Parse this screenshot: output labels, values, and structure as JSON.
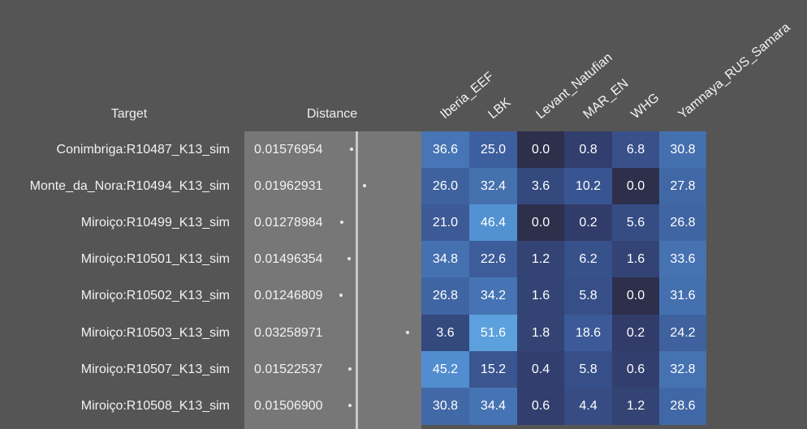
{
  "headers": {
    "target": "Target",
    "distance": "Distance",
    "columns": [
      "Iberia_EEF",
      "LBK",
      "Levant_Natufian",
      "MAR_EN",
      "WHG",
      "Yamnaya_RUS_Samara"
    ]
  },
  "rows": [
    {
      "target": "Conimbriga:R10487_K13_sim",
      "distance": "0.01576954",
      "distance_value": 0.01576954,
      "values": [
        "36.6",
        "25.0",
        "0.0",
        "0.8",
        "6.8",
        "30.8"
      ],
      "colors": [
        "#4775b5",
        "#3e5f9f",
        "#2d2f4b",
        "#323e6e",
        "#38518a",
        "#4570b0"
      ]
    },
    {
      "target": "Monte_da_Nora:R10494_K13_sim",
      "distance": "0.01962931",
      "distance_value": 0.01962931,
      "values": [
        "26.0",
        "32.4",
        "3.6",
        "10.2",
        "0.0",
        "27.8"
      ],
      "colors": [
        "#3f629f",
        "#4571ae",
        "#34497e",
        "#395591",
        "#2d2f4b",
        "#4168a6"
      ]
    },
    {
      "target": "Miroiço:R10499_K13_sim",
      "distance": "0.01278984",
      "distance_value": 0.01278984,
      "values": [
        "21.0",
        "46.4",
        "0.0",
        "0.2",
        "5.6",
        "26.8"
      ],
      "colors": [
        "#3c5a96",
        "#5292d2",
        "#2d2f4b",
        "#313c6b",
        "#364d84",
        "#4065a3"
      ]
    },
    {
      "target": "Miroiço:R10501_K13_sim",
      "distance": "0.01496354",
      "distance_value": 0.01496354,
      "values": [
        "34.8",
        "22.6",
        "1.2",
        "6.2",
        "1.6",
        "33.6"
      ],
      "colors": [
        "#4671b1",
        "#3d5d9a",
        "#334373",
        "#37518a",
        "#334474",
        "#4672b2"
      ]
    },
    {
      "target": "Miroiço:R10502_K13_sim",
      "distance": "0.01246809",
      "distance_value": 0.01246809,
      "values": [
        "26.8",
        "34.2",
        "1.6",
        "5.8",
        "0.0",
        "31.6"
      ],
      "colors": [
        "#4065a3",
        "#4673b3",
        "#334474",
        "#374f88",
        "#2d2f4b",
        "#4570b0"
      ]
    },
    {
      "target": "Miroiço:R10503_K13_sim",
      "distance": "0.03258971",
      "distance_value": 0.03258971,
      "values": [
        "3.6",
        "51.6",
        "1.8",
        "18.6",
        "0.2",
        "24.2"
      ],
      "colors": [
        "#34497e",
        "#5ca0de",
        "#334474",
        "#3b5a97",
        "#313c6b",
        "#3f629f"
      ]
    },
    {
      "target": "Miroiço:R10507_K13_sim",
      "distance": "0.01522537",
      "distance_value": 0.01522537,
      "values": [
        "45.2",
        "15.2",
        "0.4",
        "5.8",
        "0.6",
        "32.8"
      ],
      "colors": [
        "#528ecf",
        "#3a5590",
        "#323e6e",
        "#374f88",
        "#323e6e",
        "#4672b2"
      ]
    },
    {
      "target": "Miroiço:R10508_K13_sim",
      "distance": "0.01506900",
      "distance_value": 0.015069,
      "values": [
        "30.8",
        "34.4",
        "0.6",
        "4.4",
        "1.2",
        "28.6"
      ],
      "colors": [
        "#4269a7",
        "#4673b3",
        "#323e6e",
        "#364c83",
        "#334373",
        "#4168a6"
      ]
    }
  ]
}
